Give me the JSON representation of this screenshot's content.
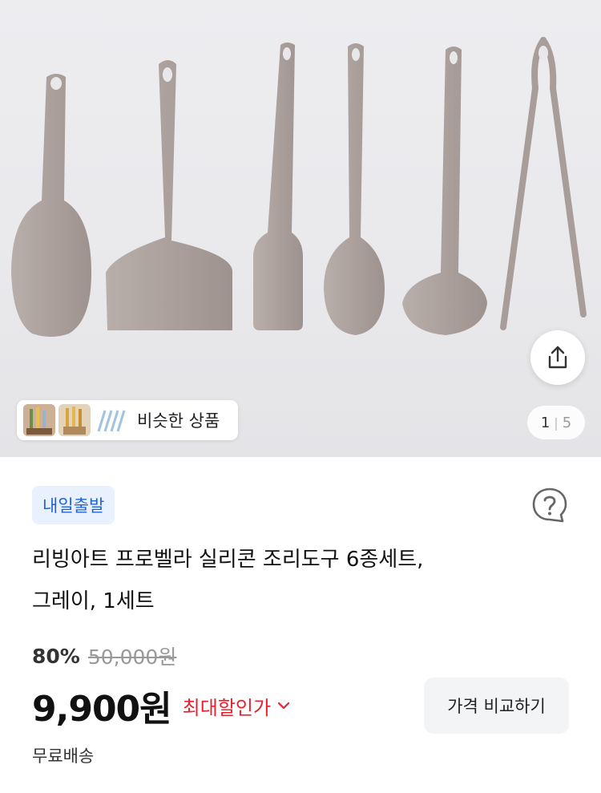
{
  "gallery": {
    "current_page": "1",
    "separator": "|",
    "total_pages": "5",
    "similar_label": "비슷한 상품",
    "share_icon": "share-icon"
  },
  "product": {
    "badge": "내일출발",
    "title_line1": "리빙아트 프로벨라 실리콘 조리도구 6종세트,",
    "title_line2": "그레이, 1세트",
    "discount_rate": "80%",
    "original_price": "50,000원",
    "price": "9,900원",
    "best_price_label": "최대할인가",
    "compare_button": "가격 비교하기",
    "shipping": "무료배송"
  },
  "colors": {
    "badge_text": "#2063d6",
    "badge_bg": "#e9f1fe",
    "best_price": "#e8212f",
    "tool_color": "#aea39f"
  }
}
